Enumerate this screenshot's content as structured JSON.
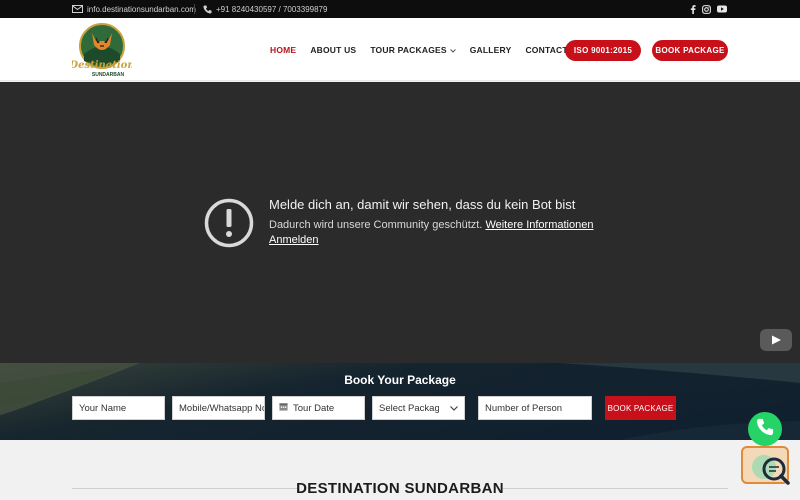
{
  "topbar": {
    "email": "info.destinationsundarban.com",
    "phone": "+91 8240430597 / 7003399879",
    "social_icons": [
      "facebook-icon",
      "instagram-icon",
      "youtube-icon"
    ]
  },
  "header": {
    "logo_text_top": "Destination",
    "logo_text_bottom": "SUNDARBAN",
    "nav": [
      {
        "label": "HOME",
        "active": true
      },
      {
        "label": "ABOUT US",
        "active": false
      },
      {
        "label": "TOUR PACKAGES",
        "active": false,
        "dropdown": true
      },
      {
        "label": "GALLERY",
        "active": false
      },
      {
        "label": "CONTACT US",
        "active": false
      }
    ],
    "iso_label": "ISO 9001:2015",
    "book_label": "BOOK PACKAGE"
  },
  "video": {
    "title": "Melde dich an, damit wir sehen, dass du kein Bot bist",
    "subtitle": "Dadurch wird unsere Community geschützt.",
    "more_info_link": "Weitere Informationen",
    "signin_link": "Anmelden"
  },
  "booking": {
    "heading": "Book Your Package",
    "name_placeholder": "Your Name",
    "mobile_placeholder": "Mobile/Whatsapp No",
    "date_placeholder": "Tour Date",
    "package_selected": "Select Package",
    "persons_placeholder": "Number of Person",
    "submit_label": "BOOK PACKAGE"
  },
  "section": {
    "title": "DESTINATION SUNDARBAN"
  },
  "colors": {
    "brand_red": "#c8101a",
    "whatsapp": "#25d366",
    "topbar_bg": "#0d0d0d"
  }
}
